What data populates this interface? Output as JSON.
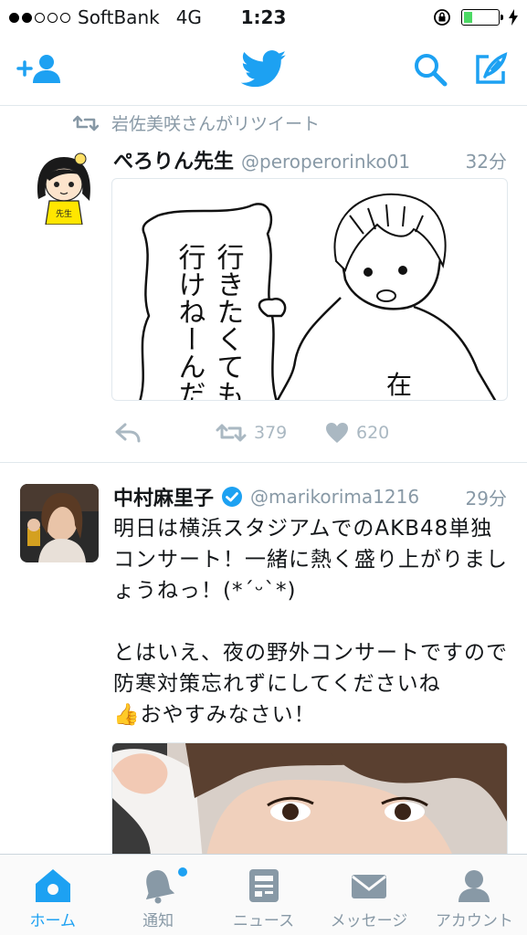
{
  "status_bar": {
    "carrier": "SoftBank",
    "network": "4G",
    "time": "1:23",
    "signal_bars_filled": 2,
    "signal_bars_total": 5,
    "battery_level": 0.25
  },
  "navbar": {
    "icons": [
      "add-user-icon",
      "twitter-bird-icon",
      "search-icon",
      "compose-icon"
    ],
    "brand_color": "#1da1f2"
  },
  "tweets": [
    {
      "retweet_by": "岩佐美咲さんがリツイート",
      "name": "ぺろりん先生",
      "handle": "@peroperorinko01",
      "time": "32分",
      "image_speech_text": "行きたくても行けねーんだ",
      "image_shirt_text": "在",
      "avatar_shirt_text": "先生",
      "retweets": "379",
      "likes": "620"
    },
    {
      "name": "中村麻里子",
      "verified": true,
      "handle": "@marikorima1216",
      "time": "29分",
      "text": "明日は横浜スタジアムでのAKB48単独コンサート！一緒に熱く盛り上がりましょうねっ！(*ˊᵕˋ*)\n\nとはいえ、夜の野外コンサートですので防寒対策忘れずにしてくださいね\n👍おやすみなさい！"
    }
  ],
  "tabbar": {
    "tabs": [
      {
        "label": "ホーム",
        "icon": "home-icon",
        "active": true
      },
      {
        "label": "通知",
        "icon": "bell-icon",
        "active": false
      },
      {
        "label": "ニュース",
        "icon": "news-icon",
        "active": false
      },
      {
        "label": "メッセージ",
        "icon": "envelope-icon",
        "active": false
      },
      {
        "label": "アカウント",
        "icon": "account-icon",
        "active": false
      }
    ],
    "active_color": "#1da1f2",
    "inactive_color": "#8899a6"
  }
}
